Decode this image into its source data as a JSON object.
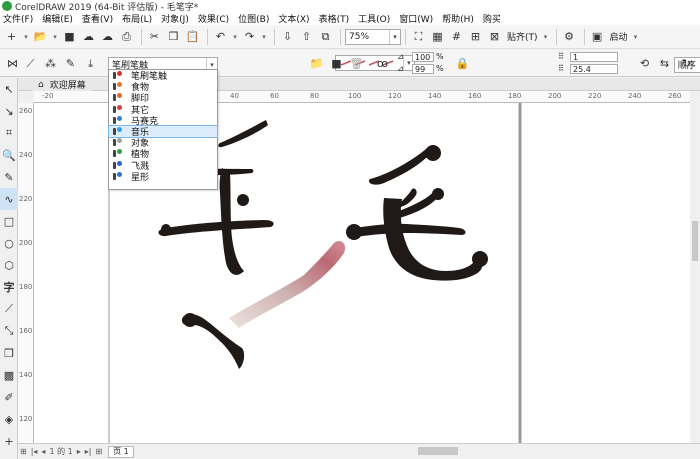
{
  "titlebar": {
    "title": "CorelDRAW 2019 (64-Bit 评估版) - 毛笔字*"
  },
  "menu": [
    "文件(F)",
    "编辑(E)",
    "查看(V)",
    "布局(L)",
    "对象(J)",
    "效果(C)",
    "位图(B)",
    "文本(X)",
    "表格(T)",
    "工具(O)",
    "窗口(W)",
    "帮助(H)",
    "购买"
  ],
  "stdbar": {
    "zoom": "75%",
    "snap_label": "贴齐(T)",
    "launch_label": "启动",
    "icons": [
      "new-icon",
      "open-icon",
      "save-icon",
      "cloud-download-icon",
      "cloud-upload-icon",
      "print-icon",
      "cut-icon",
      "copy-icon",
      "paste-icon",
      "undo-icon",
      "redo-icon",
      "import-icon",
      "export-icon",
      "pdf-icon",
      "fullscreen-icon",
      "rulers-icon",
      "grid-icon",
      "guidelines-icon",
      "options-gear-icon",
      "launch-app-icon"
    ]
  },
  "propbar": {
    "category": "笔刷笔触",
    "opacity_top": "100",
    "opacity_bottom": "99",
    "percent": "%",
    "order": "顺序",
    "width_top": "1",
    "width_value": "25.4"
  },
  "dropdown": {
    "items": [
      {
        "label": "笔刷笔触",
        "spark": "#e03030"
      },
      {
        "label": "食物",
        "spark": "#e07830"
      },
      {
        "label": "脚印",
        "spark": "#e06820"
      },
      {
        "label": "其它",
        "spark": "#d04040"
      },
      {
        "label": "马赛克",
        "spark": "#3080d0"
      },
      {
        "label": "音乐",
        "spark": "#30a0e0"
      },
      {
        "label": "对象",
        "spark": "#a0a0a0"
      },
      {
        "label": "植物",
        "spark": "#30a040"
      },
      {
        "label": "飞溅",
        "spark": "#3060d0"
      },
      {
        "label": "星形",
        "spark": "#3070d0"
      }
    ],
    "selected_index": 5
  },
  "tabs": {
    "welcome": "欢迎屏幕"
  },
  "ruler": {
    "h_labels": [
      "-20",
      "0",
      "20",
      "40",
      "60",
      "80",
      "100",
      "120",
      "140",
      "160",
      "180",
      "200",
      "220",
      "240",
      "260",
      "280"
    ],
    "v_labels": [
      "260",
      "240",
      "220",
      "200",
      "180",
      "160",
      "140",
      "120"
    ]
  },
  "bottom": {
    "page_counter": "1 的 1",
    "page_tab": "页 1"
  },
  "colors": {
    "ink": "#1f1a17",
    "brush_pink": "#c95563",
    "dropdown_highlight": "#dcecfa"
  }
}
